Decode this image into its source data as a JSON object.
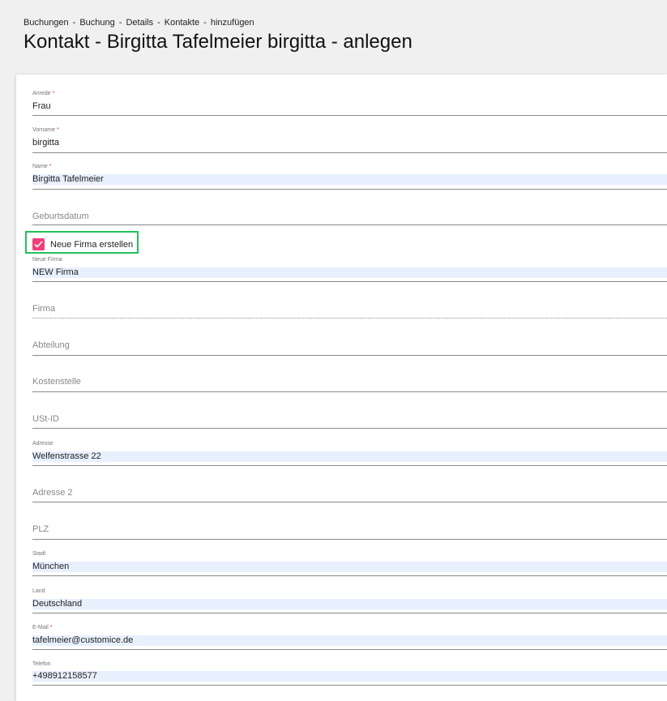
{
  "breadcrumb": [
    "Buchungen",
    "Buchung",
    "Details",
    "Kontakte",
    "hinzufügen"
  ],
  "breadcrumb_separator": "-",
  "title": "Kontakt -  Birgitta Tafelmeier birgitta  - anlegen",
  "form": {
    "anrede": {
      "label": "Anrede",
      "required": "*",
      "value": "Frau"
    },
    "vorname": {
      "label": "Vorname",
      "required": "*",
      "value": "birgitta"
    },
    "name": {
      "label": "Name",
      "required": "*",
      "value": "Birgitta Tafelmeier"
    },
    "geburtsdatum": {
      "placeholder": "Geburtsdatum"
    },
    "neue_firma_checkbox": {
      "label": "Neue Firma erstellen",
      "checked": true
    },
    "neue_firma": {
      "label": "Neue Firma",
      "value": "NEW Firma"
    },
    "firma": {
      "placeholder": "Firma"
    },
    "abteilung": {
      "placeholder": "Abteilung"
    },
    "kostenstelle": {
      "placeholder": "Kostenstelle"
    },
    "ust_id": {
      "placeholder": "USt-ID"
    },
    "adresse": {
      "label": "Adresse",
      "value": "Welfenstrasse 22"
    },
    "adresse2": {
      "placeholder": "Adresse 2"
    },
    "plz": {
      "placeholder": "PLZ"
    },
    "stadt": {
      "label": "Stadt",
      "value": "München"
    },
    "land": {
      "label": "Land",
      "value": "Deutschland"
    },
    "email": {
      "label": "E-Mail",
      "required": "*",
      "value": "tafelmeier@customice.de"
    },
    "telefon": {
      "label": "Telefon",
      "value": "+498912158577"
    }
  },
  "colors": {
    "accent": "#ec407a",
    "highlight": "#22c05a",
    "autofill": "#e8f0fe"
  }
}
